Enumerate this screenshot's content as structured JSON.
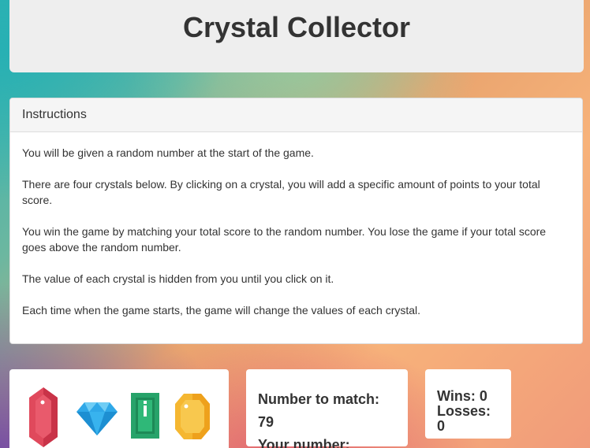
{
  "app": {
    "title": "Crystal Collector"
  },
  "instructions": {
    "heading": "Instructions",
    "paragraphs": [
      "You will be given a random number at the start of the game.",
      "There are four crystals below. By clicking on a crystal, you will add a specific amount of points to your total score.",
      "You win the game by matching your total score to the random number. You lose the game if your total score goes above the random number.",
      "The value of each crystal is hidden from you until you click on it.",
      "Each time when the game starts, the game will change the values of each crystal."
    ]
  },
  "crystals": [
    {
      "icon": "red-crystal-icon",
      "color": "#e0495c"
    },
    {
      "icon": "blue-diamond-icon",
      "color": "#2fa8e8"
    },
    {
      "icon": "green-crystal-icon",
      "color": "#27a36a"
    },
    {
      "icon": "yellow-crystal-icon",
      "color": "#f5b731"
    }
  ],
  "score": {
    "target_label": "Number to match:",
    "target_value": "79",
    "your_label": "Your number:",
    "your_value": ""
  },
  "record": {
    "wins_label": "Wins:",
    "wins": "0",
    "losses_label": "Losses:",
    "losses": "0"
  }
}
